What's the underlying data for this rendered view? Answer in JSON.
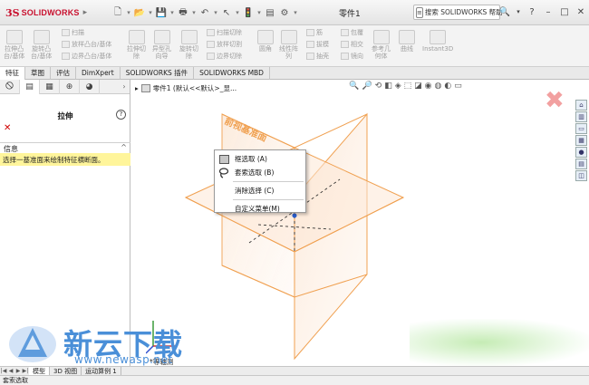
{
  "app": {
    "logo_ds": "3S",
    "logo_text": "SOLIDWORKS",
    "document_title": "零件1",
    "help_search_placeholder": "搜索 SOLIDWORKS 帮助",
    "window_buttons": [
      "?",
      "–",
      "□",
      "✕"
    ]
  },
  "ribbon": {
    "big_buttons": [
      {
        "label": "拉伸凸\n台/基体"
      },
      {
        "label": "旋转凸\n台/基体"
      },
      {
        "label": "拉伸切\n除"
      },
      {
        "label": "异型孔\n向导"
      },
      {
        "label": "旋转切\n除"
      },
      {
        "label": "圆角"
      },
      {
        "label": "线性阵\n列"
      },
      {
        "label": "参考几\n何体"
      },
      {
        "label": "曲线"
      },
      {
        "label": "Instant3D"
      }
    ],
    "small_buttons": [
      "扫描",
      "放样凸台/基体",
      "边界凸台/基体",
      "扫描切除",
      "放样切割",
      "边界切除",
      "筋",
      "拔模",
      "抽壳",
      "包覆",
      "相交",
      "镜向"
    ]
  },
  "tabs": [
    "特征",
    "草图",
    "评估",
    "DimXpert",
    "SOLIDWORKS 插件",
    "SOLIDWORKS MBD"
  ],
  "property_manager": {
    "title": "拉伸",
    "help": "?",
    "info_header": "信息",
    "info_text": "选择一基准面来绘制特征横断面。"
  },
  "graphics": {
    "tree_label": "零件1  (默认<<默认>_显...",
    "plane_label": "前视基准面",
    "triad_label": "*等轴测"
  },
  "context_menu": {
    "items": [
      {
        "label": "框选取 (A)",
        "icon": "box-select-icon"
      },
      {
        "label": "套索选取 (B)",
        "icon": "lasso-icon"
      },
      {
        "label": "消除选择 (C)",
        "icon": ""
      },
      {
        "label": "自定义菜单(M)",
        "icon": ""
      }
    ]
  },
  "bottom_tabs": [
    "模型",
    "3D 视图",
    "运动算例 1"
  ],
  "status_text": "套索选取",
  "watermark": {
    "site_name": "新云下载",
    "url": "www.newasp.net"
  },
  "colors": {
    "plane_orange": "#f0a050",
    "info_highlight": "#fff59b",
    "brand_red": "#c8102e"
  }
}
